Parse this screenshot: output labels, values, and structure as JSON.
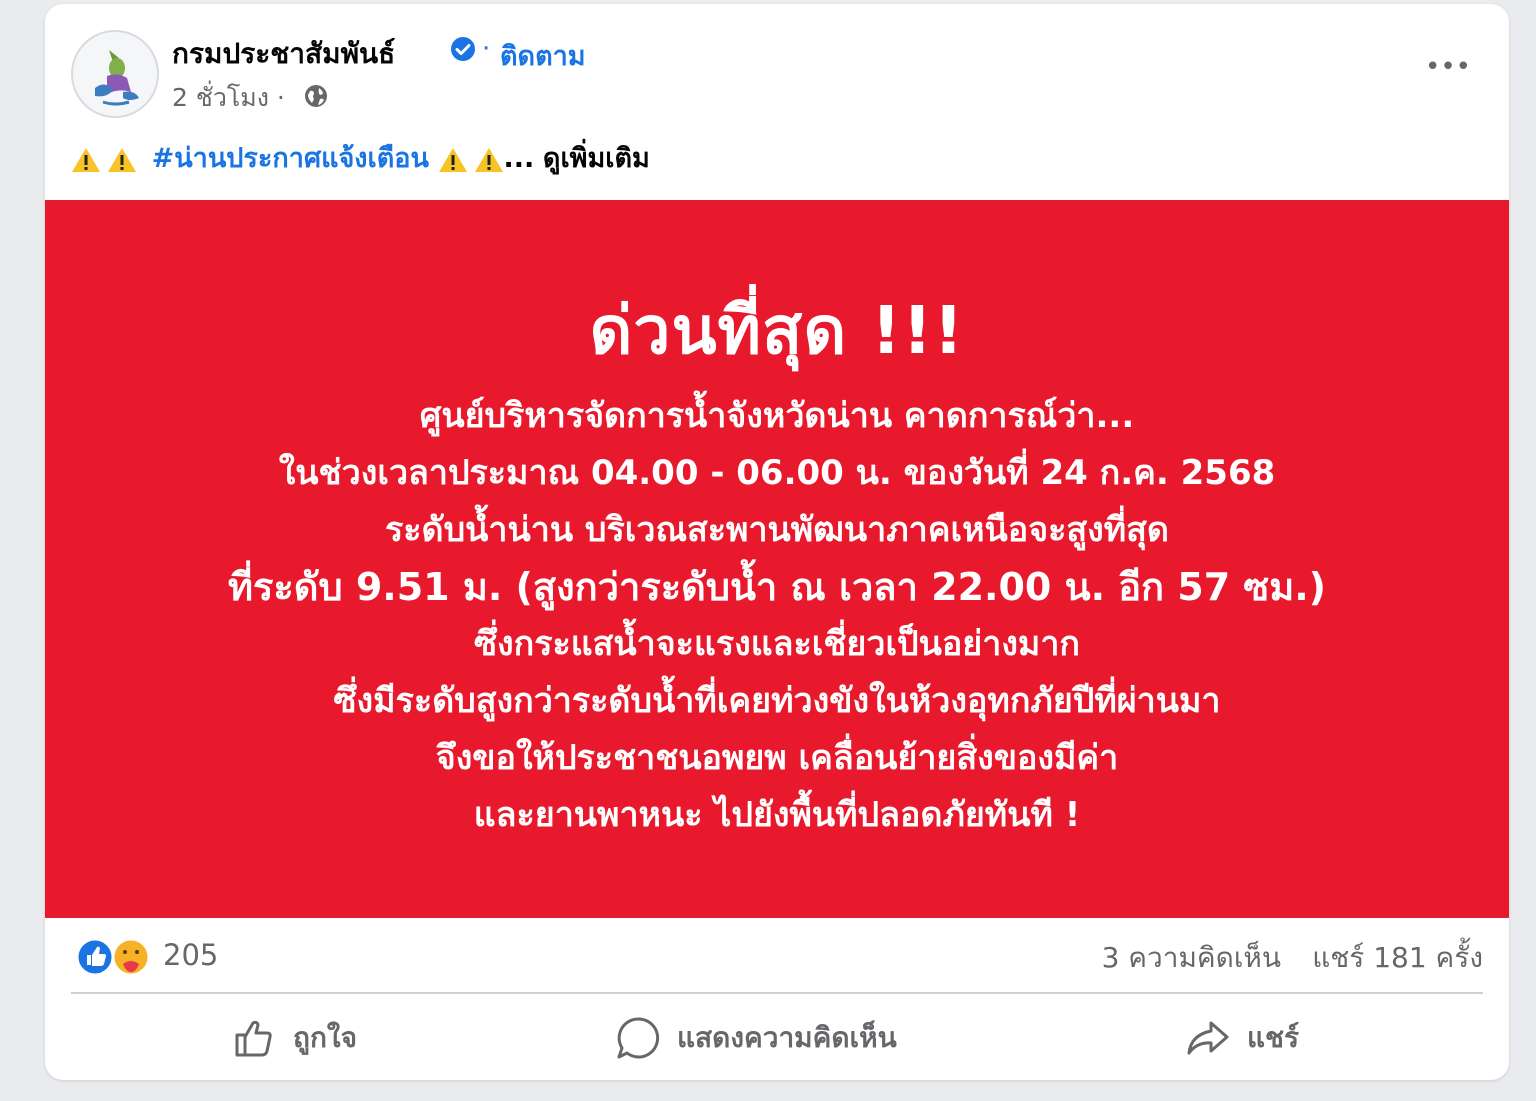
{
  "post": {
    "page_name": "กรมประชาสัมพันธ์",
    "follow_label": "ติดตาม",
    "time": "2 ชั่วโมง ·",
    "caption_hashtag": "#น่านประกาศแจ้งเตือน",
    "caption_ellipsis": "...",
    "see_more": "ดูเพิ่มเติม",
    "more_label": "•••"
  },
  "alert": {
    "title": "ด่วนที่สุด !!!",
    "lines": [
      "ศูนย์บริหารจัดการน้ำจังหวัดน่าน คาดการณ์ว่า...",
      "ในช่วงเวลาประมาณ 04.00 - 06.00 น. ของวันที่ 24 ก.ค. 2568",
      "ระดับน้ำน่าน บริเวณสะพานพัฒนาภาคเหนือจะสูงที่สุด",
      "ที่ระดับ 9.51 ม. (สูงกว่าระดับน้ำ ณ เวลา 22.00 น. อีก 57 ซม.)",
      "ซึ่งกระแสน้ำจะแรงและเชี่ยวเป็นอย่างมาก",
      "ซึ่งมีระดับสูงกว่าระดับน้ำที่เคยท่วงขังในห้วงอุทกภัยปีที่ผ่านมา",
      "จึงขอให้ประชาชนอพยพ เคลื่อนย้ายสิ่งของมีค่า",
      "และยานพาหนะ ไปยังพื้นที่ปลอดภัยทันที !"
    ],
    "background_color": "#e8192c"
  },
  "stats": {
    "reactions_count": "205",
    "comments": "3 ความคิดเห็น",
    "shares": "แชร์ 181 ครั้ง"
  },
  "actions": {
    "like": "ถูกใจ",
    "comment": "แสดงความคิดเห็น",
    "share": "แชร์"
  },
  "icons": {
    "verified": "verified-badge-icon",
    "globe": "globe-icon",
    "warning": "warning-icon",
    "like_reaction": "like-reaction-icon",
    "care_reaction": "care-reaction-icon"
  },
  "colors": {
    "link_blue": "#1b74e4",
    "secondary_text": "#65676b"
  }
}
